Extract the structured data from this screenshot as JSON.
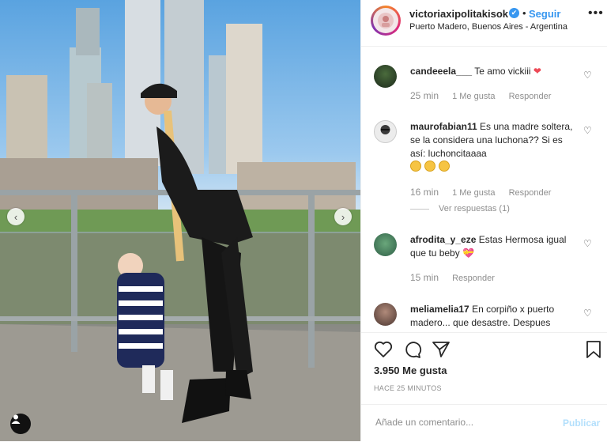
{
  "post": {
    "username": "victoriaxipolitakisok",
    "verified_mark": "✔",
    "dot": "•",
    "follow_label": "Seguir",
    "location": "Puerto Madero, Buenos Aires - Argentina",
    "more_icon": "more-horizontal-icon",
    "nav_prev": "‹",
    "nav_next": "›"
  },
  "comments": [
    {
      "user": "candeeela___",
      "text": "Te amo vickiii",
      "emoji": "red-heart",
      "time": "25 min",
      "likes": "1 Me gusta",
      "reply": "Responder"
    },
    {
      "user": "maurofabian11",
      "text": "Es una madre soltera, se la considera una luchona?? Si es así: luchoncitaaaa",
      "emoji": "grinning-faces",
      "time": "16 min",
      "likes": "1 Me gusta",
      "reply": "Responder",
      "view_replies": "Ver respuestas (1)"
    },
    {
      "user": "afrodita_y_eze",
      "text": "Estas Hermosa igual que tu beby",
      "emoji": "heart-box",
      "time": "15 min",
      "reply": "Responder"
    },
    {
      "user": "meliamelia17",
      "text": "En corpiño x puerto madero... que desastre. Despues"
    }
  ],
  "stats": {
    "likes": "3.950 Me gusta",
    "posted_ago": "HACE 25 MINUTOS"
  },
  "composer": {
    "placeholder": "Añade un comentario...",
    "publish_label": "Publicar"
  },
  "colors": {
    "accent": "#3897f0",
    "heart": "#ed4956",
    "muted": "#8e8e8e"
  }
}
